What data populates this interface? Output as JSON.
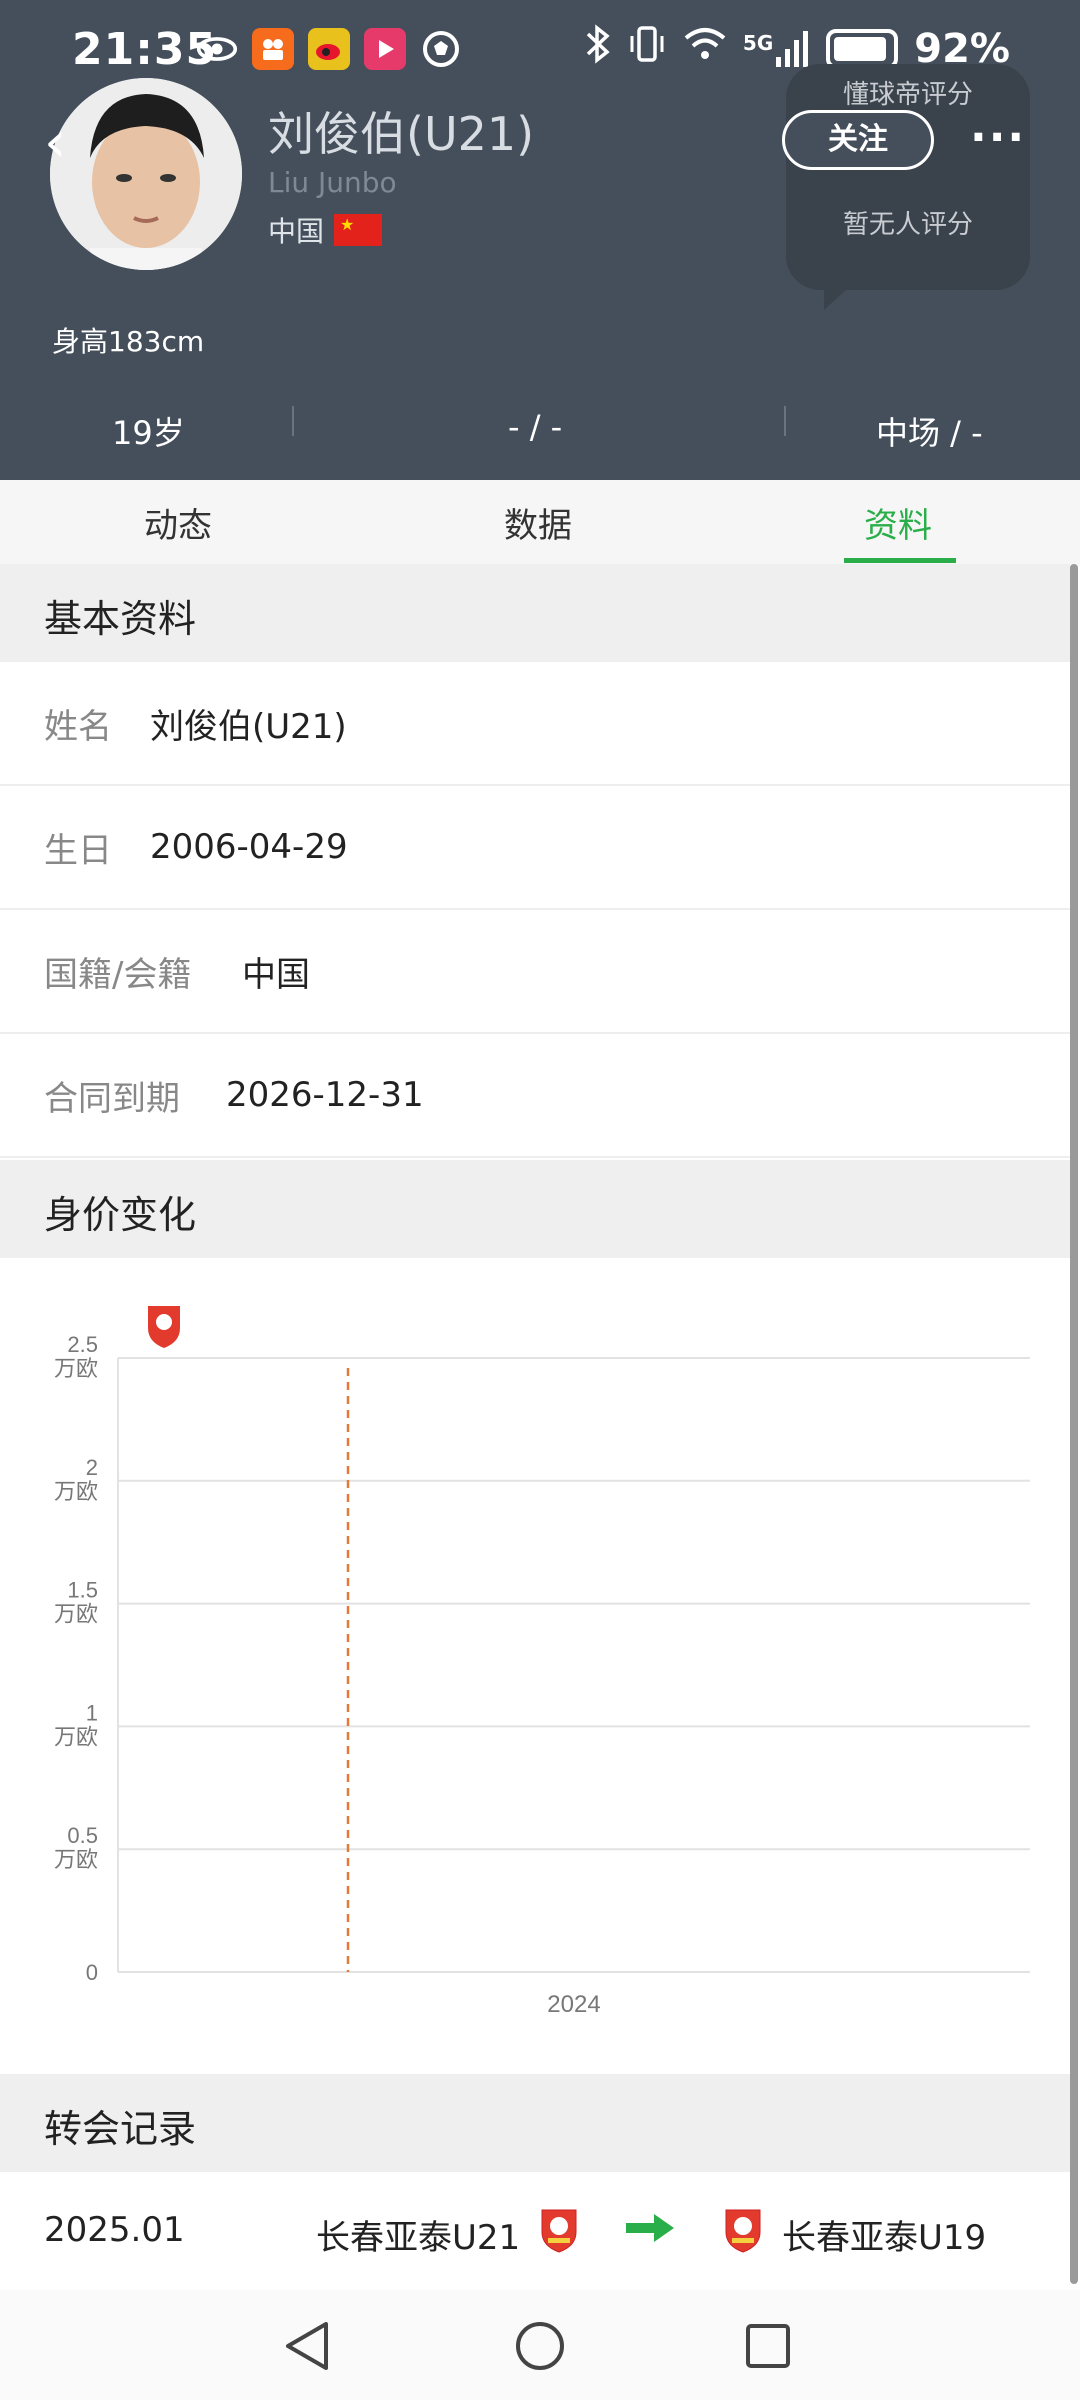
{
  "status": {
    "time": "21:35",
    "network": "5G",
    "battery": "92%"
  },
  "player": {
    "name": "刘俊伯(U21)",
    "name_en": "Liu Junbo",
    "country": "中国",
    "height": "身高183cm",
    "follow_label": "关注",
    "more_label": "···",
    "rating_title": "懂球帝评分",
    "rating_value": "暂无人评分"
  },
  "stats": {
    "age": "19岁",
    "middle": "- / -",
    "position": "中场 / -"
  },
  "tabs": [
    {
      "label": "动态"
    },
    {
      "label": "数据"
    },
    {
      "label": "资料"
    }
  ],
  "basic": {
    "title": "基本资料",
    "rows": [
      {
        "label": "姓名",
        "value": "刘俊伯(U21)"
      },
      {
        "label": "生日",
        "value": "2006-04-29"
      },
      {
        "label": "国籍/会籍",
        "value": "中国"
      },
      {
        "label": "合同到期",
        "value": "2026-12-31"
      }
    ]
  },
  "value_section": {
    "title": "身价变化"
  },
  "chart_data": {
    "type": "line",
    "title": "",
    "xlabel": "",
    "ylabel": "",
    "y_ticks": [
      {
        "value": 0,
        "label": "0",
        "unit": ""
      },
      {
        "value": 0.5,
        "label": "0.5",
        "unit": "万欧"
      },
      {
        "value": 1,
        "label": "1",
        "unit": "万欧"
      },
      {
        "value": 1.5,
        "label": "1.5",
        "unit": "万欧"
      },
      {
        "value": 2,
        "label": "2",
        "unit": "万欧"
      },
      {
        "value": 2.5,
        "label": "2.5",
        "unit": "万欧"
      }
    ],
    "ylim": [
      0,
      2.5
    ],
    "x_ticks": [
      "2024"
    ],
    "grid": true,
    "series": [],
    "annotations": [
      "transfer marker: 长春亚泰 club badge"
    ]
  },
  "transfer": {
    "title": "转会记录",
    "records": [
      {
        "date": "2025.01",
        "from": "长春亚泰U21",
        "to": "长春亚泰U19"
      }
    ]
  },
  "colors": {
    "header_bg": "#454f5b",
    "accent_green": "#2aae49",
    "section_bg": "#efefef",
    "dashed_line": "#e07b3a"
  }
}
